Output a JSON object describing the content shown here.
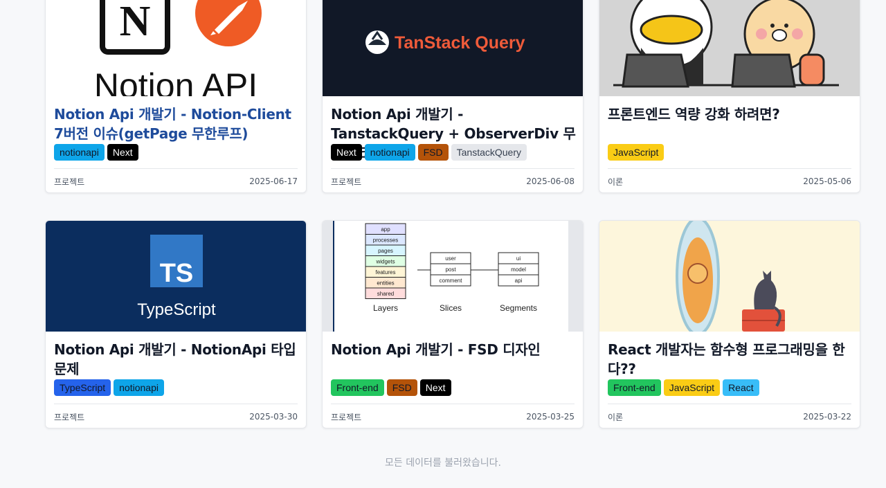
{
  "posts": [
    {
      "title": "Notion Api 개발기 - Notion-Client 7버전 이슈(getPage 무한루프)",
      "thumb_text": "Notion API",
      "thumb_icons": [
        "notion-logo-icon",
        "postman-logo-icon"
      ],
      "tags": [
        {
          "label": "notionapi",
          "bg": "#0ea5e9",
          "fg": "#111827"
        },
        {
          "label": "Next",
          "bg": "#000000",
          "fg": "#ffffff"
        }
      ],
      "category": "프로젝트",
      "date": "2025-06-17"
    },
    {
      "title": "Notion Api 개발기 - TanstackQuery + ObserverDiv 무한스크롤",
      "thumb_text": "TanStack Query",
      "thumb_icons": [
        "tanstack-logo-icon"
      ],
      "tags": [
        {
          "label": "Next",
          "bg": "#000000",
          "fg": "#ffffff"
        },
        {
          "label": "notionapi",
          "bg": "#0ea5e9",
          "fg": "#111827"
        },
        {
          "label": "FSD",
          "bg": "#b45309",
          "fg": "#111827"
        },
        {
          "label": "TanstackQuery",
          "bg": "#e5e7eb",
          "fg": "#374151"
        }
      ],
      "category": "프로젝트",
      "date": "2025-06-08"
    },
    {
      "title": "프론트엔드 역량 강화 하려면?",
      "thumb_icons": [
        "cartoon-animals-laptops-icon"
      ],
      "tags": [
        {
          "label": "JavaScript",
          "bg": "#facc15",
          "fg": "#111827"
        }
      ],
      "category": "이론",
      "date": "2025-05-06"
    },
    {
      "title": "Notion Api 개발기 - NotionApi 타입 문제",
      "thumb_text": "TypeScript",
      "thumb_badge": "TS",
      "thumb_icons": [
        "typescript-logo-icon"
      ],
      "tags": [
        {
          "label": "TypeScript",
          "bg": "#2563eb",
          "fg": "#111827"
        },
        {
          "label": "notionapi",
          "bg": "#0ea5e9",
          "fg": "#111827"
        }
      ],
      "category": "프로젝트",
      "date": "2025-03-30"
    },
    {
      "title": "Notion Api 개발기 - FSD 디자인",
      "fsd": {
        "layers": [
          "app",
          "processes",
          "pages",
          "widgets",
          "features",
          "entities",
          "shared"
        ],
        "slices": [
          "user",
          "post",
          "comment"
        ],
        "segments": [
          "ui",
          "model",
          "api"
        ],
        "labels": [
          "Layers",
          "Slices",
          "Segments"
        ]
      },
      "tags": [
        {
          "label": "Front-end",
          "bg": "#22c55e",
          "fg": "#111827"
        },
        {
          "label": "FSD",
          "bg": "#b45309",
          "fg": "#111827"
        },
        {
          "label": "Next",
          "bg": "#000000",
          "fg": "#ffffff"
        }
      ],
      "category": "프로젝트",
      "date": "2025-03-25"
    },
    {
      "title": "React 개발자는 함수형 프로그래밍을 한다??",
      "thumb_icons": [
        "cat-mirror-lion-illustration-icon"
      ],
      "tags": [
        {
          "label": "Front-end",
          "bg": "#22c55e",
          "fg": "#111827"
        },
        {
          "label": "JavaScript",
          "bg": "#facc15",
          "fg": "#111827"
        },
        {
          "label": "React",
          "bg": "#38bdf8",
          "fg": "#111827"
        }
      ],
      "category": "이론",
      "date": "2025-03-22"
    }
  ],
  "footer": {
    "status": "모든 데이터를 불러왔습니다."
  },
  "colors": {
    "active_title": "#1e4b9b",
    "page_bg": "#f7f8fa"
  }
}
